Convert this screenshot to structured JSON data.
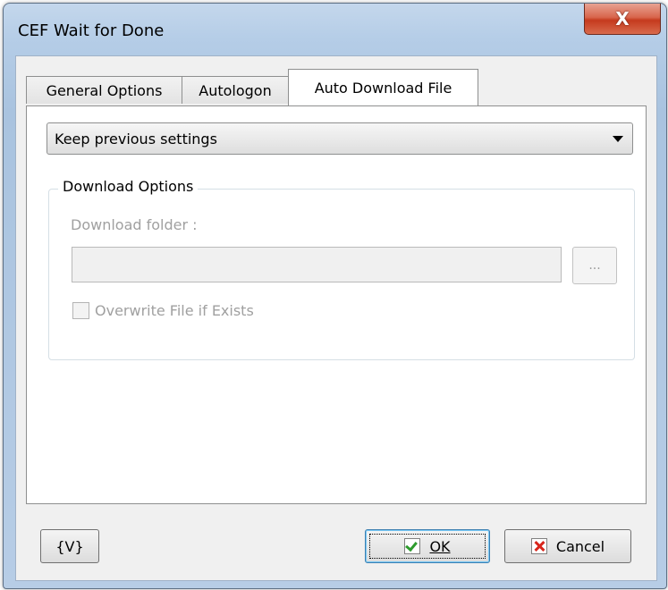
{
  "window": {
    "title": "CEF Wait for Done",
    "close_glyph": "X"
  },
  "tabs": [
    {
      "label": "General Options"
    },
    {
      "label": "Autologon"
    },
    {
      "label": "Auto Download File"
    }
  ],
  "mode_select": {
    "selected": "Keep previous settings"
  },
  "download_options": {
    "group_title": "Download Options",
    "folder_label": "Download folder :",
    "folder_value": "",
    "browse_label": "...",
    "overwrite_label": "Overwrite File if Exists",
    "overwrite_checked": false
  },
  "footer": {
    "variables_label": "{V}",
    "ok_label": "OK",
    "cancel_label": "Cancel"
  },
  "colors": {
    "titlebar": "#b5cde7",
    "close_button": "#c53a1e",
    "ok_check": "#2d9b2d",
    "cancel_x": "#d8261c"
  }
}
